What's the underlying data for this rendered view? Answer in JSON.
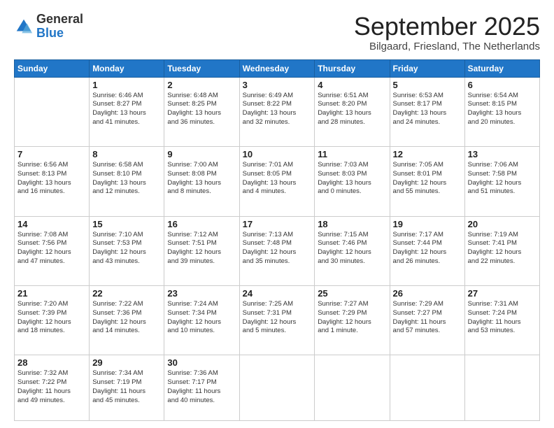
{
  "logo": {
    "general": "General",
    "blue": "Blue"
  },
  "header": {
    "month": "September 2025",
    "location": "Bilgaard, Friesland, The Netherlands"
  },
  "weekdays": [
    "Sunday",
    "Monday",
    "Tuesday",
    "Wednesday",
    "Thursday",
    "Friday",
    "Saturday"
  ],
  "weeks": [
    [
      {
        "day": "",
        "info": ""
      },
      {
        "day": "1",
        "info": "Sunrise: 6:46 AM\nSunset: 8:27 PM\nDaylight: 13 hours\nand 41 minutes."
      },
      {
        "day": "2",
        "info": "Sunrise: 6:48 AM\nSunset: 8:25 PM\nDaylight: 13 hours\nand 36 minutes."
      },
      {
        "day": "3",
        "info": "Sunrise: 6:49 AM\nSunset: 8:22 PM\nDaylight: 13 hours\nand 32 minutes."
      },
      {
        "day": "4",
        "info": "Sunrise: 6:51 AM\nSunset: 8:20 PM\nDaylight: 13 hours\nand 28 minutes."
      },
      {
        "day": "5",
        "info": "Sunrise: 6:53 AM\nSunset: 8:17 PM\nDaylight: 13 hours\nand 24 minutes."
      },
      {
        "day": "6",
        "info": "Sunrise: 6:54 AM\nSunset: 8:15 PM\nDaylight: 13 hours\nand 20 minutes."
      }
    ],
    [
      {
        "day": "7",
        "info": "Sunrise: 6:56 AM\nSunset: 8:13 PM\nDaylight: 13 hours\nand 16 minutes."
      },
      {
        "day": "8",
        "info": "Sunrise: 6:58 AM\nSunset: 8:10 PM\nDaylight: 13 hours\nand 12 minutes."
      },
      {
        "day": "9",
        "info": "Sunrise: 7:00 AM\nSunset: 8:08 PM\nDaylight: 13 hours\nand 8 minutes."
      },
      {
        "day": "10",
        "info": "Sunrise: 7:01 AM\nSunset: 8:05 PM\nDaylight: 13 hours\nand 4 minutes."
      },
      {
        "day": "11",
        "info": "Sunrise: 7:03 AM\nSunset: 8:03 PM\nDaylight: 13 hours\nand 0 minutes."
      },
      {
        "day": "12",
        "info": "Sunrise: 7:05 AM\nSunset: 8:01 PM\nDaylight: 12 hours\nand 55 minutes."
      },
      {
        "day": "13",
        "info": "Sunrise: 7:06 AM\nSunset: 7:58 PM\nDaylight: 12 hours\nand 51 minutes."
      }
    ],
    [
      {
        "day": "14",
        "info": "Sunrise: 7:08 AM\nSunset: 7:56 PM\nDaylight: 12 hours\nand 47 minutes."
      },
      {
        "day": "15",
        "info": "Sunrise: 7:10 AM\nSunset: 7:53 PM\nDaylight: 12 hours\nand 43 minutes."
      },
      {
        "day": "16",
        "info": "Sunrise: 7:12 AM\nSunset: 7:51 PM\nDaylight: 12 hours\nand 39 minutes."
      },
      {
        "day": "17",
        "info": "Sunrise: 7:13 AM\nSunset: 7:48 PM\nDaylight: 12 hours\nand 35 minutes."
      },
      {
        "day": "18",
        "info": "Sunrise: 7:15 AM\nSunset: 7:46 PM\nDaylight: 12 hours\nand 30 minutes."
      },
      {
        "day": "19",
        "info": "Sunrise: 7:17 AM\nSunset: 7:44 PM\nDaylight: 12 hours\nand 26 minutes."
      },
      {
        "day": "20",
        "info": "Sunrise: 7:19 AM\nSunset: 7:41 PM\nDaylight: 12 hours\nand 22 minutes."
      }
    ],
    [
      {
        "day": "21",
        "info": "Sunrise: 7:20 AM\nSunset: 7:39 PM\nDaylight: 12 hours\nand 18 minutes."
      },
      {
        "day": "22",
        "info": "Sunrise: 7:22 AM\nSunset: 7:36 PM\nDaylight: 12 hours\nand 14 minutes."
      },
      {
        "day": "23",
        "info": "Sunrise: 7:24 AM\nSunset: 7:34 PM\nDaylight: 12 hours\nand 10 minutes."
      },
      {
        "day": "24",
        "info": "Sunrise: 7:25 AM\nSunset: 7:31 PM\nDaylight: 12 hours\nand 5 minutes."
      },
      {
        "day": "25",
        "info": "Sunrise: 7:27 AM\nSunset: 7:29 PM\nDaylight: 12 hours\nand 1 minute."
      },
      {
        "day": "26",
        "info": "Sunrise: 7:29 AM\nSunset: 7:27 PM\nDaylight: 11 hours\nand 57 minutes."
      },
      {
        "day": "27",
        "info": "Sunrise: 7:31 AM\nSunset: 7:24 PM\nDaylight: 11 hours\nand 53 minutes."
      }
    ],
    [
      {
        "day": "28",
        "info": "Sunrise: 7:32 AM\nSunset: 7:22 PM\nDaylight: 11 hours\nand 49 minutes."
      },
      {
        "day": "29",
        "info": "Sunrise: 7:34 AM\nSunset: 7:19 PM\nDaylight: 11 hours\nand 45 minutes."
      },
      {
        "day": "30",
        "info": "Sunrise: 7:36 AM\nSunset: 7:17 PM\nDaylight: 11 hours\nand 40 minutes."
      },
      {
        "day": "",
        "info": ""
      },
      {
        "day": "",
        "info": ""
      },
      {
        "day": "",
        "info": ""
      },
      {
        "day": "",
        "info": ""
      }
    ]
  ]
}
